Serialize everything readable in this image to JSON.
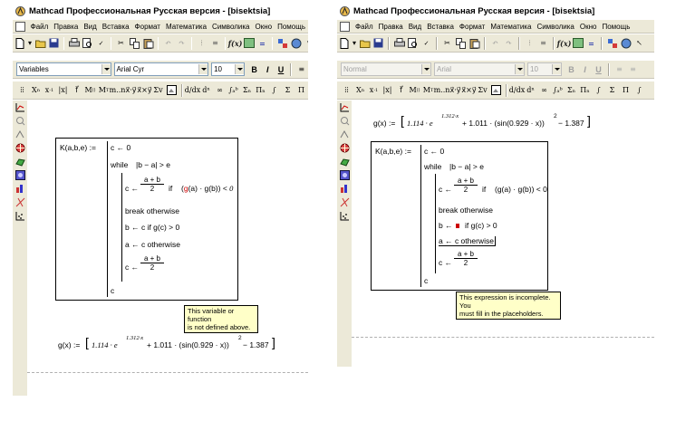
{
  "left_window": {
    "title": "Mathcad Профессиональная Русская версия - [bisektsia]",
    "menu": [
      "Файл",
      "Правка",
      "Вид",
      "Вставка",
      "Формат",
      "Математика",
      "Символика",
      "Окно",
      "Помощь"
    ],
    "format_bar": {
      "style": "Variables",
      "font": "Arial Cyr",
      "size": "10",
      "bold": "B",
      "italic": "I",
      "underline": "U"
    },
    "program": {
      "header": "K(a,b,e) :=",
      "line1": "c ← 0",
      "while_kw": "while",
      "while_cond": "|b − a| > e",
      "assign_c": "c ←",
      "frac_num": "a + b",
      "frac_den": "2",
      "if1": "if",
      "if1_cond": "(g(a) · g(b)) < 0",
      "break_line": "break   otherwise",
      "b_line": "b ← c   if   g(c) > 0",
      "a_line": "a ← c   otherwise",
      "return_c": "c"
    },
    "tooltip": "This variable or function\nis not defined above.",
    "gx": {
      "lhs": "g(x) :=",
      "body": "1.114 · e",
      "exp": "1.312·x",
      "mid": "+ 1.011 · (sin(0.929 · x))",
      "sq": "2",
      "tail": "− 1.387"
    }
  },
  "right_window": {
    "title": "Mathcad Профессиональная Русская версия - [bisektsia]",
    "menu": [
      "Файл",
      "Правка",
      "Вид",
      "Вставка",
      "Формат",
      "Математика",
      "Символика",
      "Окно",
      "Помощь"
    ],
    "format_bar": {
      "style": "Normal",
      "font": "Arial",
      "size": "10",
      "bold": "B",
      "italic": "I",
      "underline": "U"
    },
    "gx": {
      "lhs": "g(x) :=",
      "body": "1.114 · e",
      "exp": "1.312·x",
      "mid": "+ 1.011 · (sin(0.929 · x))",
      "sq": "2",
      "tail": "− 1.387"
    },
    "program": {
      "header": "K(a,b,e) :=",
      "line1": "c ← 0",
      "while_kw": "while",
      "while_cond": "|b − a| > e",
      "assign_c": "c ←",
      "frac_num": "a + b",
      "frac_den": "2",
      "if1": "if",
      "if1_cond": "(g(a) · g(b)) < 0",
      "break_line": "break   otherwise",
      "b_line_pre": "b ←",
      "b_line_post": "if   g(c) > 0",
      "a_line": "a ← c   otherwise",
      "c2": "c ←",
      "frac2_num": "a + b",
      "frac2_den": "2",
      "return_c": "c"
    },
    "tooltip": "This expression is incomplete. You\nmust fill in the placeholders."
  },
  "colors": {
    "error_red": "#cc0000",
    "tooltip_bg": "#ffffc8",
    "chrome": "#ece9d8"
  }
}
